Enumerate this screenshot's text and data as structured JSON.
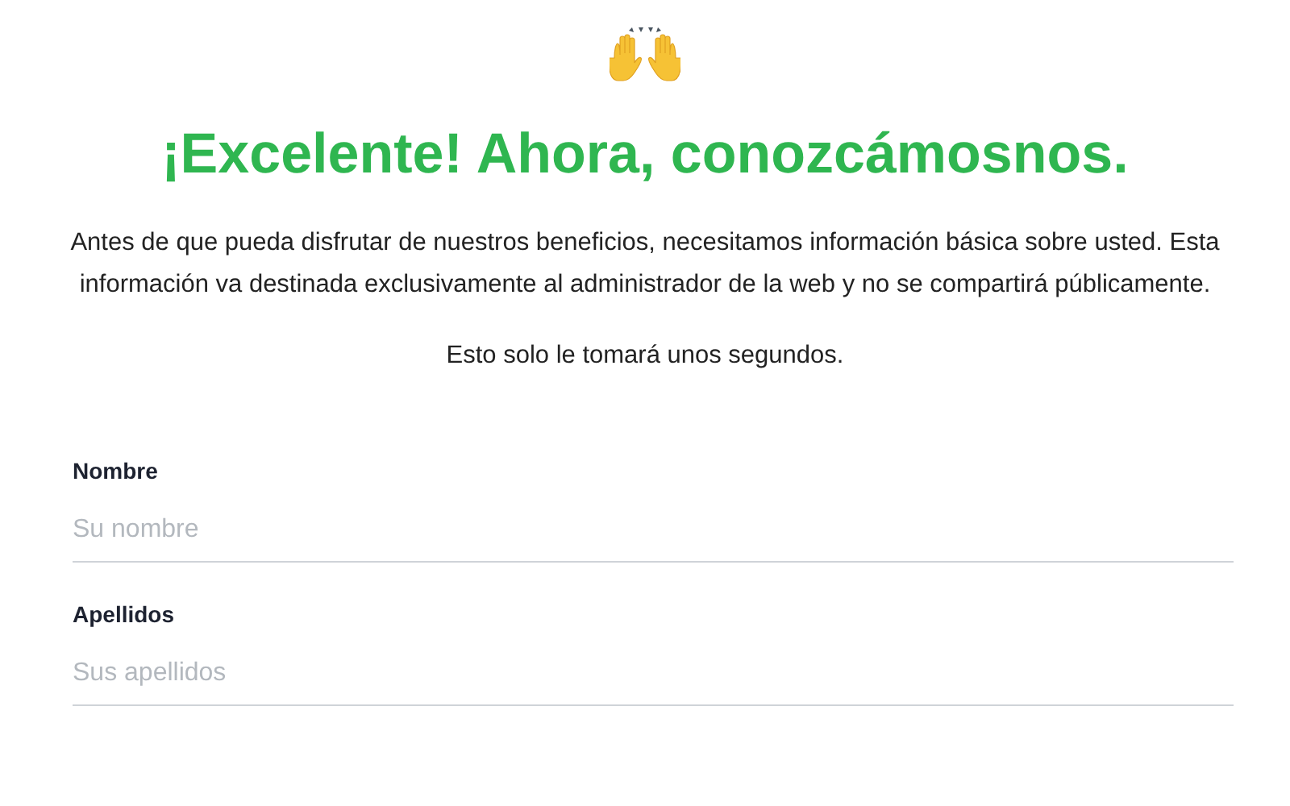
{
  "heading": "¡Excelente! Ahora, conozcámosnos.",
  "intro": [
    "Antes de que pueda disfrutar de nuestros beneficios, necesitamos información básica sobre usted. Esta información va destinada exclusivamente al administrador de la web y no se compartirá públicamente.",
    "Esto solo le tomará unos segundos."
  ],
  "fields": [
    {
      "label": "Nombre",
      "placeholder": "Su nombre"
    },
    {
      "label": "Apellidos",
      "placeholder": "Sus apellidos"
    }
  ]
}
